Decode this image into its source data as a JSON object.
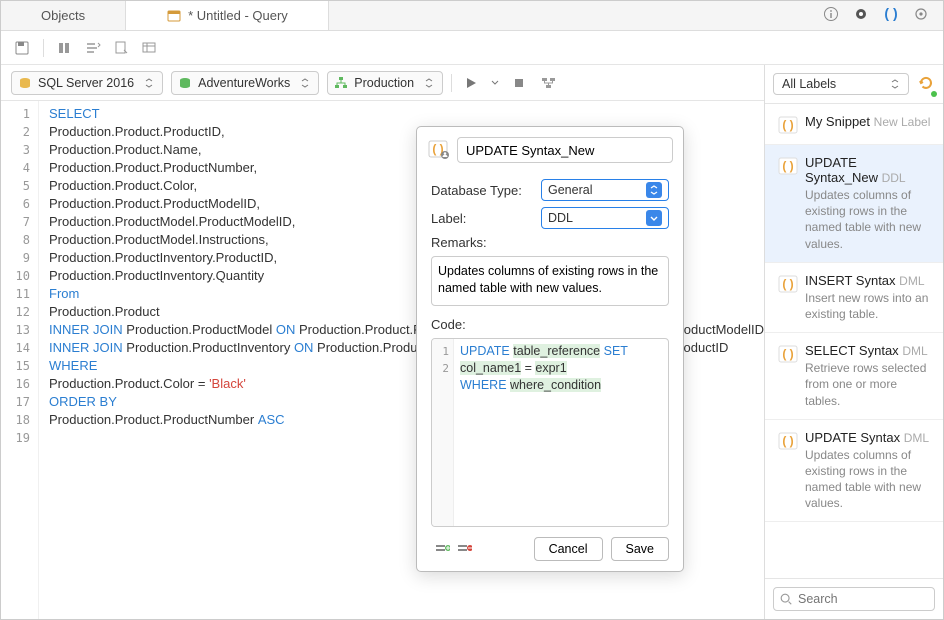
{
  "tabs": {
    "objects": "Objects",
    "query": "* Untitled - Query"
  },
  "connections": {
    "server": "SQL Server 2016",
    "database": "AdventureWorks",
    "schema": "Production"
  },
  "editor": {
    "lines": [
      {
        "n": 1,
        "html": "<span class='kw'>SELECT</span>"
      },
      {
        "n": 2,
        "html": "Production.Product.ProductID,"
      },
      {
        "n": 3,
        "html": "Production.Product.Name,"
      },
      {
        "n": 4,
        "html": "Production.Product.ProductNumber,"
      },
      {
        "n": 5,
        "html": "Production.Product.Color,"
      },
      {
        "n": 6,
        "html": "Production.Product.ProductModelID,"
      },
      {
        "n": 7,
        "html": "Production.ProductModel.ProductModelID,"
      },
      {
        "n": 8,
        "html": "Production.ProductModel.Instructions,"
      },
      {
        "n": 9,
        "html": "Production.ProductInventory.ProductID,"
      },
      {
        "n": 10,
        "html": "Production.ProductInventory.Quantity"
      },
      {
        "n": 11,
        "html": "<span class='kw'>From</span>"
      },
      {
        "n": 12,
        "html": "Production.Product"
      },
      {
        "n": 13,
        "html": "<span class='kw'>INNER JOIN</span> Production.ProductModel <span class='kw'>ON</span> Production.Product.ProductModelID = Production.ProductModel.ProductModelID"
      },
      {
        "n": 14,
        "html": "<span class='kw'>INNER JOIN</span> Production.ProductInventory <span class='kw'>ON</span> Production.Product.ProductID = Production.ProductInventory.ProductID"
      },
      {
        "n": 15,
        "html": "<span class='kw'>WHERE</span>"
      },
      {
        "n": 16,
        "html": "Production.Product.Color = <span class='str'>'Black'</span>"
      },
      {
        "n": 17,
        "html": "<span class='kw'>ORDER BY</span>"
      },
      {
        "n": 18,
        "html": "Production.Product.ProductNumber <span class='kw'>ASC</span>"
      },
      {
        "n": 19,
        "html": ""
      }
    ]
  },
  "snippetPanel": {
    "filter": "All Labels",
    "searchPlaceholder": "Search",
    "items": [
      {
        "title": "My Snippet",
        "label": "New Label",
        "desc": ""
      },
      {
        "title": "UPDATE Syntax_New",
        "label": "DDL",
        "desc": "Updates columns of existing rows in the named table with new values.",
        "selected": true
      },
      {
        "title": "INSERT Syntax",
        "label": "DML",
        "desc": "Insert new rows into an existing table."
      },
      {
        "title": "SELECT Syntax",
        "label": "DML",
        "desc": "Retrieve rows selected from one or more tables."
      },
      {
        "title": "UPDATE Syntax",
        "label": "DML",
        "desc": "Updates columns of existing rows in the named table with new values."
      }
    ]
  },
  "popup": {
    "name": "UPDATE Syntax_New",
    "dbTypeLabel": "Database Type:",
    "dbType": "General",
    "labelLabel": "Label:",
    "label": "DDL",
    "remarksLabel": "Remarks:",
    "remarks": "Updates columns of existing rows in the named table with new values.",
    "codeLabel": "Code:",
    "codeLines": [
      {
        "n": 1,
        "html": "<span class='kw'>UPDATE</span> <span class='hl'>table_reference</span> <span class='kw'>SET</span> <span class='hl'>col_name1</span> = <span class='hl'>expr1</span>"
      },
      {
        "n": 2,
        "html": "<span class='kw'>WHERE</span> <span class='hl'>where_condition</span>"
      }
    ],
    "cancel": "Cancel",
    "save": "Save"
  }
}
